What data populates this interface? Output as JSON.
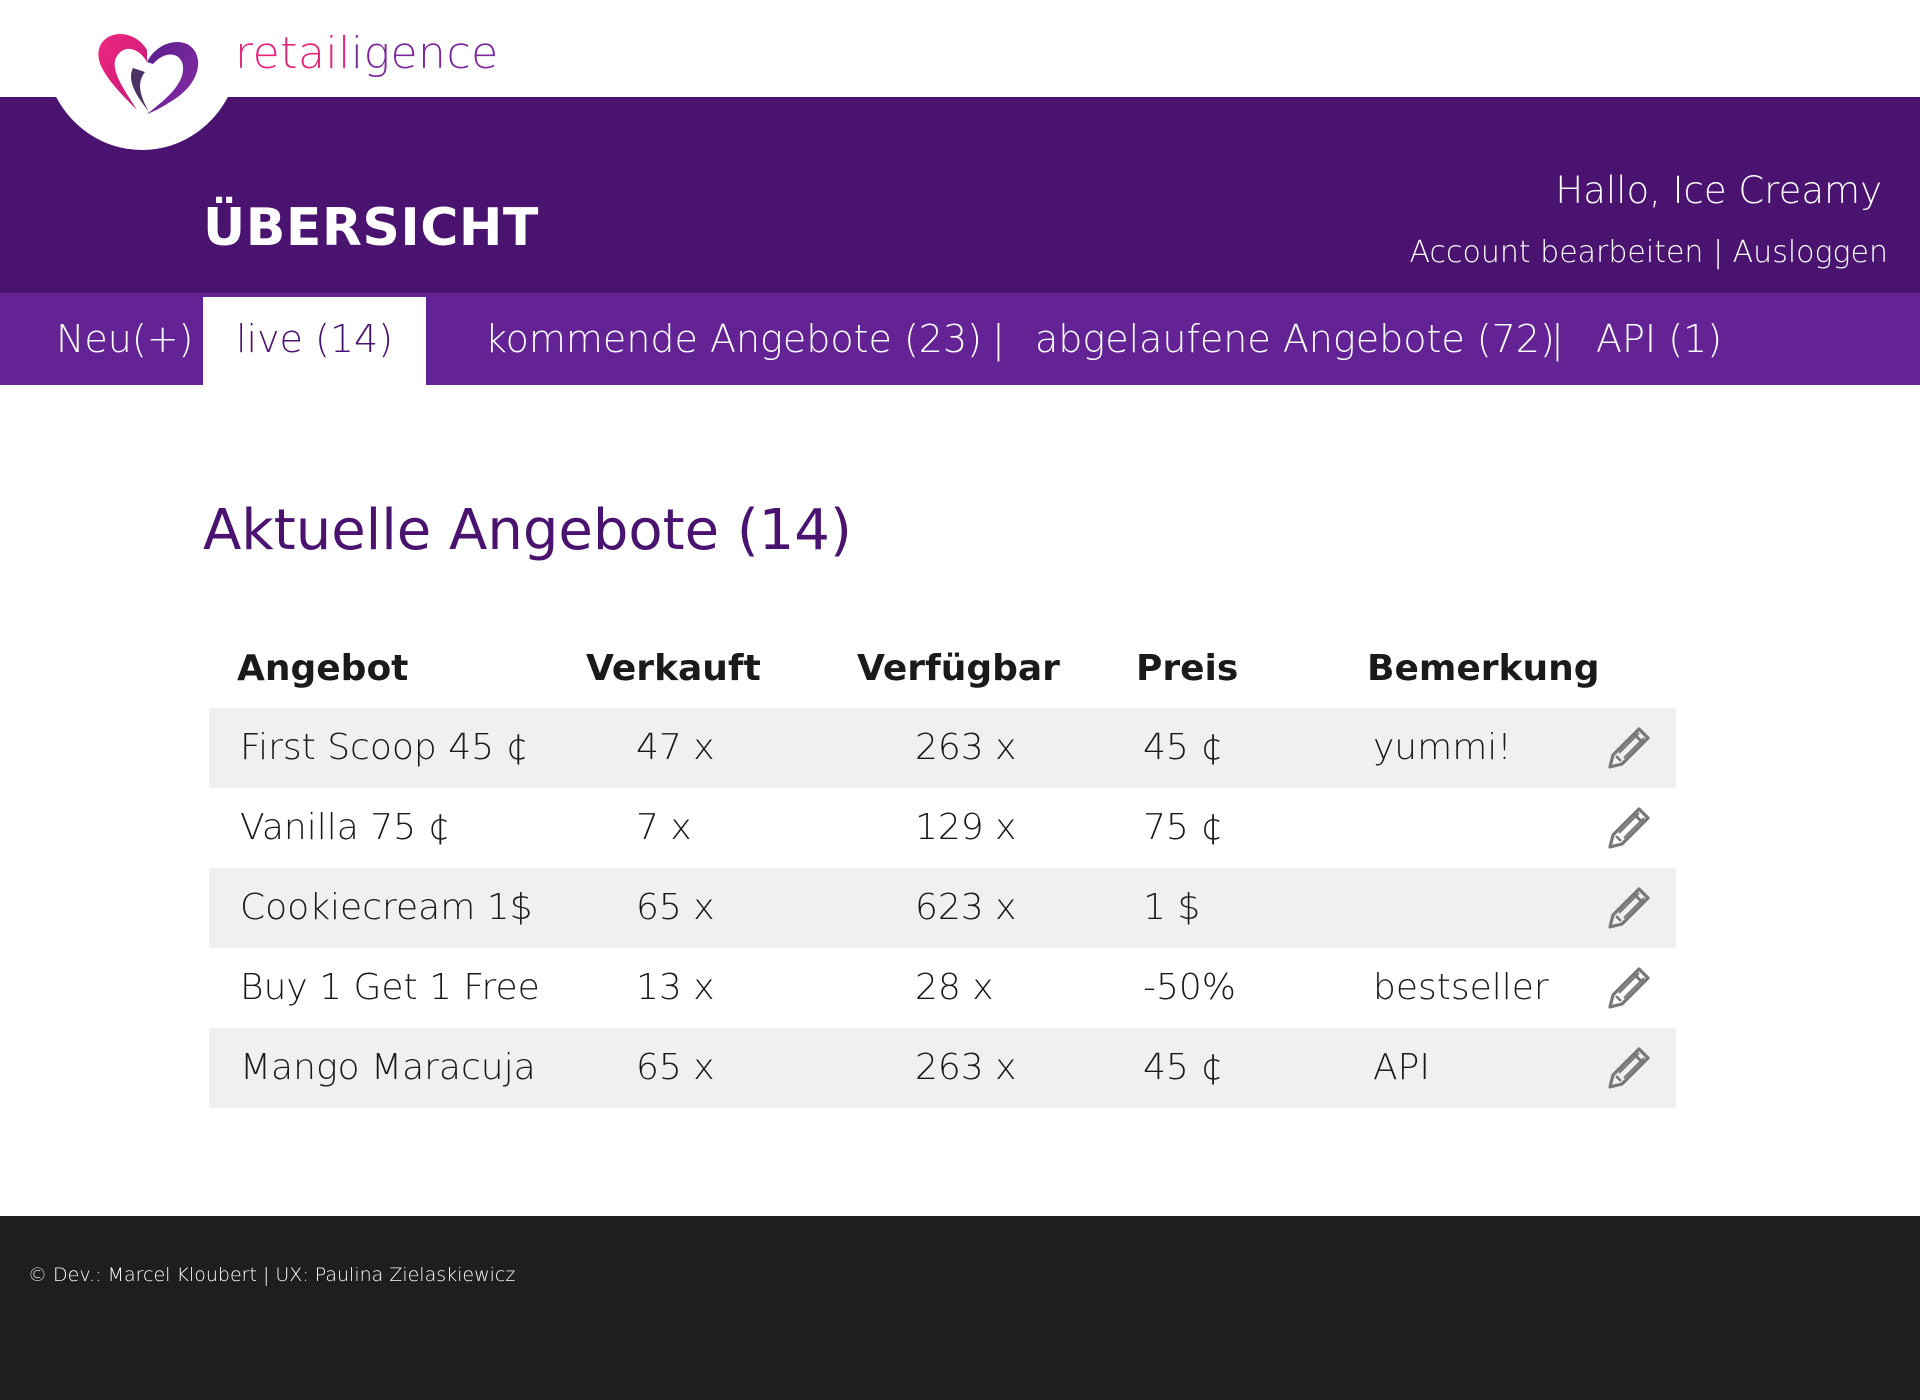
{
  "brand": {
    "name_part1": "retail",
    "name_part2": "igence",
    "colors": {
      "pink": "#e4267b",
      "purple": "#7b2a9c"
    }
  },
  "header": {
    "title": "ÜBERSICHT",
    "greeting": "Hallo, Ice Creamy",
    "edit_account": "Account bearbeiten",
    "separator": "|",
    "logout": "Ausloggen",
    "bg_color": "#4a136f"
  },
  "tabs": {
    "new": "Neu(+)",
    "live": "live (14)",
    "upcoming": "kommende Angebote (23)",
    "expired": "abgelaufene Angebote (72)",
    "api": "API (1)",
    "separator": "|",
    "active": "live (14)",
    "bg_color": "#632395"
  },
  "main": {
    "section_title": "Aktuelle Angebote (14)",
    "table": {
      "columns": [
        "Angebot",
        "Verkauft",
        "Verfügbar",
        "Preis",
        "Bemerkung"
      ],
      "rows": [
        {
          "offer": "First Scoop 45 ¢",
          "sold": "47 x",
          "available": "263 x",
          "price": "45 ¢",
          "note": "yummi!"
        },
        {
          "offer": "Vanilla 75 ¢",
          "sold": "7 x",
          "available": "129 x",
          "price": "75 ¢",
          "note": ""
        },
        {
          "offer": "Cookiecream 1$",
          "sold": "65 x",
          "available": "623 x",
          "price": "1 $",
          "note": ""
        },
        {
          "offer": "Buy 1 Get 1 Free",
          "sold": "13 x",
          "available": "28 x",
          "price": "-50%",
          "note": "bestseller"
        },
        {
          "offer": "Mango Maracuja",
          "sold": "65 x",
          "available": "263 x",
          "price": "45 ¢",
          "note": "API"
        }
      ],
      "row_icon": "pencil-icon"
    }
  },
  "footer": {
    "credits": "© Dev.: Marcel Kloubert | UX: Paulina Zielaskiewicz"
  }
}
